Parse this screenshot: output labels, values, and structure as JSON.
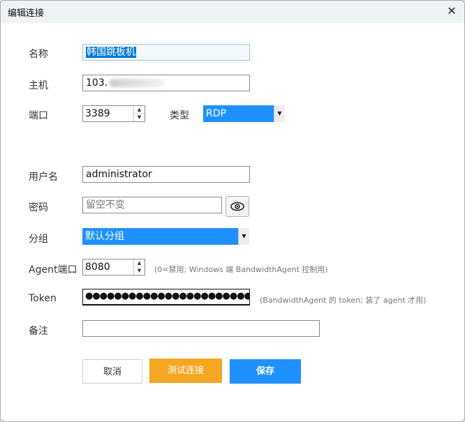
{
  "window": {
    "title": "编辑连接",
    "close_glyph": "✕"
  },
  "form": {
    "name": {
      "label": "名称",
      "value": "韩国跳板机"
    },
    "host": {
      "label": "主机",
      "value": "103."
    },
    "port": {
      "label": "端口",
      "value": "3389"
    },
    "type": {
      "label": "类型",
      "value": "RDP"
    },
    "username": {
      "label": "用户名",
      "value": "administrator"
    },
    "password": {
      "label": "密码",
      "placeholder": "留空不变"
    },
    "group": {
      "label": "分组",
      "value": "默认分组"
    },
    "agent_port": {
      "label": "Agent端口",
      "value": "8080",
      "hint": "(0=禁用; Windows 端 BandwidthAgent 控制用)"
    },
    "token": {
      "label": "Token",
      "value": "●●●●●●●●●●●●●●●●●●●●●●●●●●●●●●●●●●",
      "hint": "(BandwidthAgent 的 token; 装了 agent 才用)"
    },
    "note": {
      "label": "备注",
      "value": ""
    }
  },
  "buttons": {
    "cancel": "取消",
    "test": "测试连接",
    "save": "保存"
  },
  "colors": {
    "primary": "#1e90ff",
    "warning": "#f5a623",
    "titlebar": "#eef3f8"
  }
}
